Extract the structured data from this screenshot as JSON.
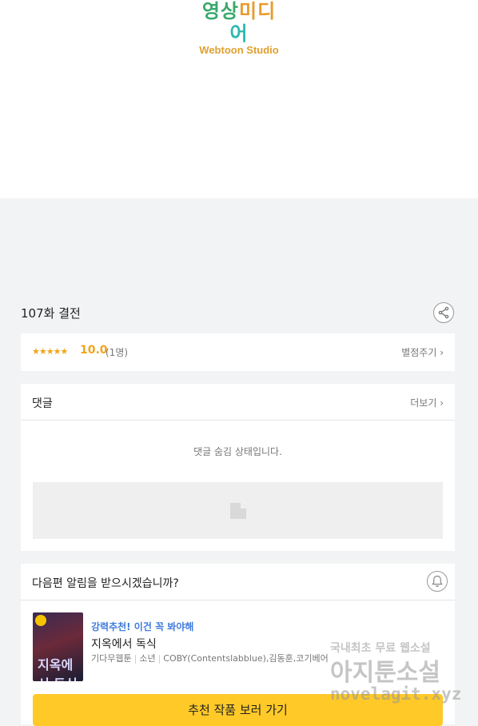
{
  "header": {
    "logo_kr_1": "영상",
    "logo_kr_2": "미디",
    "logo_kr_3": "어",
    "logo_en": "Webtoon Studio"
  },
  "episode": {
    "title": "107화 결전"
  },
  "rating": {
    "stars": "★★★★★",
    "score": "10.0",
    "count": "(1명)",
    "rate_link": "별점주기 ›"
  },
  "comments": {
    "title": "댓글",
    "more": "더보기 ›",
    "hidden_message": "댓글 숨김 상태입니다."
  },
  "notify": {
    "question": "다음편 알림을 받으시겠습니까?"
  },
  "recommendation": {
    "label": "강력추천! 이건 꼭 봐야해",
    "title": "지옥에서 독식",
    "genre": "기다무웹툰",
    "category": "소년",
    "authors": "COBY(Contentslabblue),김동훈,코기베어",
    "thumb_text": "지옥에서 독식",
    "button": "추천 작품 보러 가기"
  },
  "watermark": {
    "line1": "국내최초 무료 웹소설",
    "line2": "아지툰소설",
    "line3": "novelagit.xyz"
  },
  "colors": {
    "accent_yellow": "#ffc928",
    "rating_orange": "#f2a41c",
    "link_blue": "#3f7bdc"
  }
}
